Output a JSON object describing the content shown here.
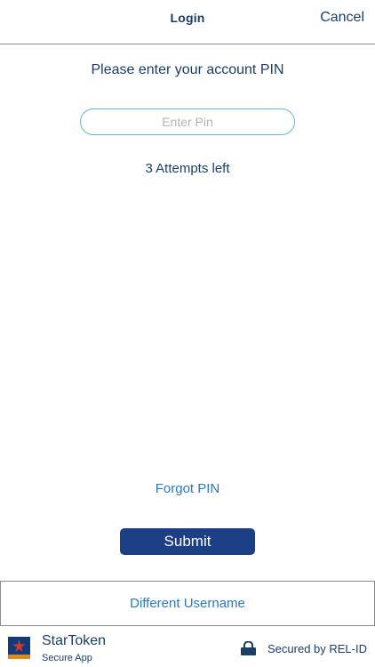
{
  "header": {
    "title": "Login",
    "cancel_label": "Cancel"
  },
  "main": {
    "prompt": "Please enter your account PIN",
    "pin_placeholder": "Enter Pin",
    "pin_value": "",
    "attempts_text": "3 Attempts left",
    "forgot_label": "Forgot PIN",
    "submit_label": "Submit",
    "different_username_label": "Different Username"
  },
  "footer": {
    "app_name": "StarToken",
    "app_subtitle": "Secure App",
    "secured_text": "Secured by REL-ID",
    "app_icon": "star-token-logo",
    "lock_icon": "lock-icon"
  },
  "colors": {
    "primary_text": "#1b3e66",
    "link": "#2a78c5",
    "button_bg": "#1d3f86",
    "input_border": "#5fb7d8"
  }
}
